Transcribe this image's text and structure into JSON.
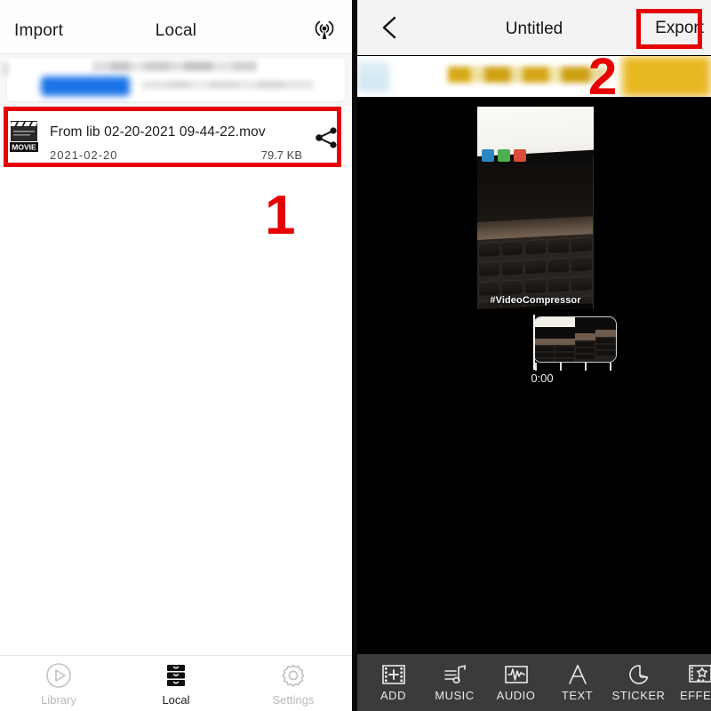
{
  "left_panel": {
    "header": {
      "import_label": "Import",
      "title": "Local",
      "cast_icon": "broadcast-icon"
    },
    "promo_banner": {
      "note": "blurred-advertisement"
    },
    "file_list": [
      {
        "icon": "movie-clapperboard-icon",
        "icon_label": "MOVIE",
        "name": "From lib 02-20-2021 09-44-22.mov",
        "date": "2021-02-20",
        "size": "79.7 KB",
        "share_icon": "share-icon"
      }
    ],
    "tabbar": [
      {
        "label": "Library",
        "icon": "play-circle-icon",
        "active": false
      },
      {
        "label": "Local",
        "icon": "drawers-icon",
        "active": true
      },
      {
        "label": "Settings",
        "icon": "gear-icon",
        "active": false
      }
    ]
  },
  "right_panel": {
    "header": {
      "back_icon": "chevron-left-icon",
      "title": "Untitled",
      "export_label": "Export"
    },
    "ad_banner": {
      "note": "blurred-yellow-advertisement"
    },
    "preview": {
      "overlay_text": "#VideoCompressor",
      "timecode": "0:00"
    },
    "toolbar": [
      {
        "label": "ADD",
        "icon": "film-plus-icon"
      },
      {
        "label": "MUSIC",
        "icon": "music-note-icon"
      },
      {
        "label": "AUDIO",
        "icon": "waveform-icon"
      },
      {
        "label": "TEXT",
        "icon": "letter-a-icon"
      },
      {
        "label": "STICKER",
        "icon": "sticker-icon"
      },
      {
        "label": "EFFEC",
        "icon": "effects-icon"
      }
    ]
  },
  "annotations": {
    "step_one": "1",
    "step_two": "2",
    "highlight_color": "#e60000"
  }
}
